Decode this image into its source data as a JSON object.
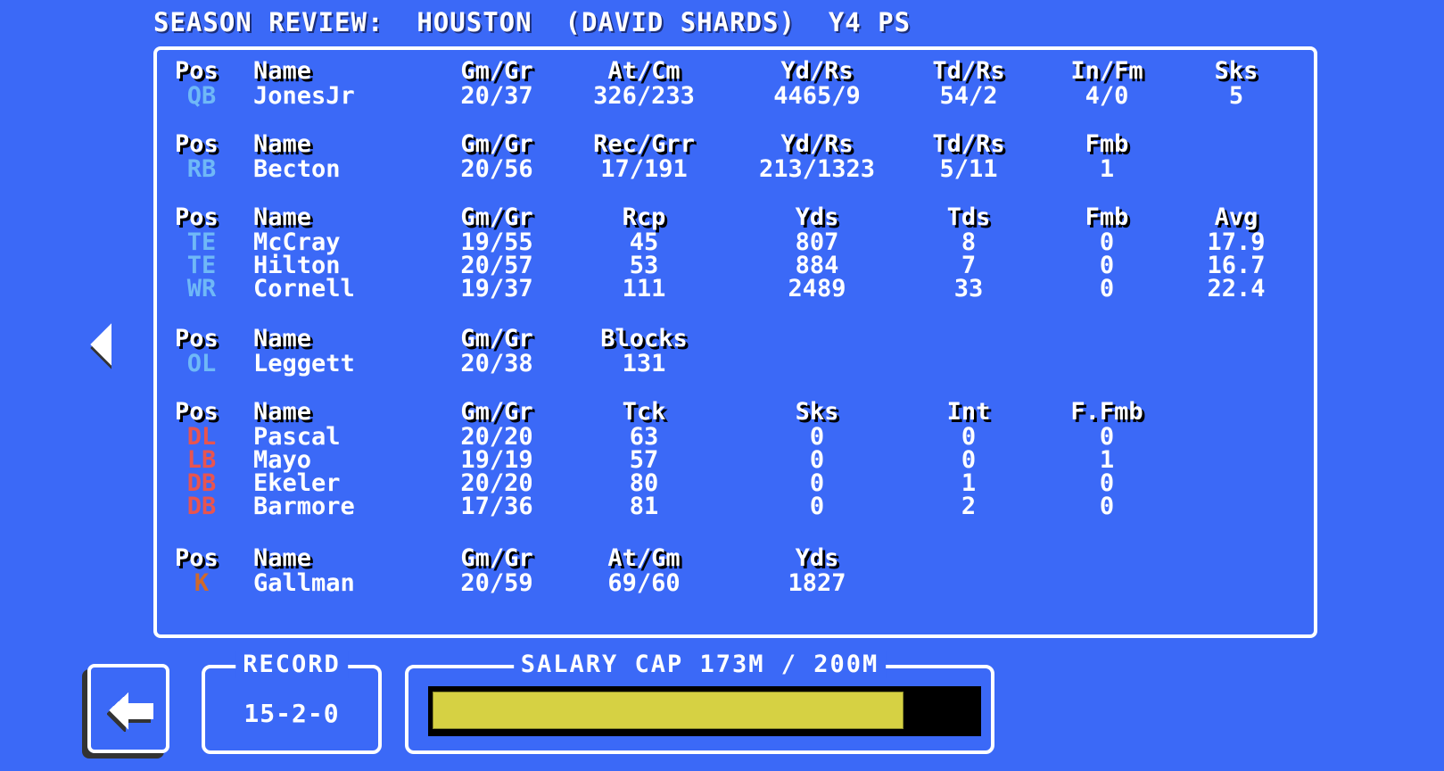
{
  "title": "SEASON REVIEW:  HOUSTON  (DAVID SHARDS)  Y4 PS",
  "colors": {
    "background": "#3b69f7",
    "offense_pos": "#6fb8f7",
    "defense_pos": "#e85450",
    "kicker_pos": "#d0692a",
    "cap_fill": "#d6d143",
    "cap_track": "#000000"
  },
  "sections": [
    {
      "id": "qb",
      "headers": [
        "Pos",
        "Name",
        "Gm/Gr",
        "At/Cm",
        "Yd/Rs",
        "Td/Rs",
        "In/Fm",
        "Sks"
      ],
      "rows": [
        {
          "pos": "QB",
          "group": "offense",
          "cells": [
            "JonesJr",
            "20/37",
            "326/233",
            "4465/9",
            "54/2",
            "4/0",
            "5"
          ]
        }
      ]
    },
    {
      "id": "rb",
      "headers": [
        "Pos",
        "Name",
        "Gm/Gr",
        "Rec/Grr",
        "Yd/Rs",
        "Td/Rs",
        "Fmb"
      ],
      "rows": [
        {
          "pos": "RB",
          "group": "offense",
          "cells": [
            "Becton",
            "20/56",
            "17/191",
            "213/1323",
            "5/11",
            "1"
          ]
        }
      ]
    },
    {
      "id": "receivers",
      "headers": [
        "Pos",
        "Name",
        "Gm/Gr",
        "Rcp",
        "Yds",
        "Tds",
        "Fmb",
        "Avg"
      ],
      "rows": [
        {
          "pos": "TE",
          "group": "offense",
          "cells": [
            "McCray",
            "19/55",
            "45",
            "807",
            "8",
            "0",
            "17.9"
          ]
        },
        {
          "pos": "TE",
          "group": "offense",
          "cells": [
            "Hilton",
            "20/57",
            "53",
            "884",
            "7",
            "0",
            "16.7"
          ]
        },
        {
          "pos": "WR",
          "group": "offense",
          "cells": [
            "Cornell",
            "19/37",
            "111",
            "2489",
            "33",
            "0",
            "22.4"
          ]
        }
      ]
    },
    {
      "id": "ol",
      "headers": [
        "Pos",
        "Name",
        "Gm/Gr",
        "Blocks"
      ],
      "rows": [
        {
          "pos": "OL",
          "group": "offense",
          "cells": [
            "Leggett",
            "20/38",
            "131"
          ]
        }
      ]
    },
    {
      "id": "defense",
      "headers": [
        "Pos",
        "Name",
        "Gm/Gr",
        "Tck",
        "Sks",
        "Int",
        "F.Fmb"
      ],
      "rows": [
        {
          "pos": "DL",
          "group": "defense",
          "cells": [
            "Pascal",
            "20/20",
            "63",
            "0",
            "0",
            "0"
          ]
        },
        {
          "pos": "LB",
          "group": "defense",
          "cells": [
            "Mayo",
            "19/19",
            "57",
            "0",
            "0",
            "1"
          ]
        },
        {
          "pos": "DB",
          "group": "defense",
          "cells": [
            "Ekeler",
            "20/20",
            "80",
            "0",
            "1",
            "0"
          ]
        },
        {
          "pos": "DB",
          "group": "defense",
          "cells": [
            "Barmore",
            "17/36",
            "81",
            "0",
            "2",
            "0"
          ]
        }
      ]
    },
    {
      "id": "kicker",
      "headers": [
        "Pos",
        "Name",
        "Gm/Gr",
        "At/Gm",
        "Yds"
      ],
      "rows": [
        {
          "pos": "K",
          "group": "kicker",
          "cells": [
            "Gallman",
            "20/59",
            "69/60",
            "1827"
          ]
        }
      ]
    }
  ],
  "record": {
    "label": "RECORD",
    "value": "15-2-0"
  },
  "salary_cap": {
    "label": "SALARY CAP 173M / 200M",
    "used_millions": 173,
    "cap_millions": 200,
    "fraction": 0.865
  },
  "icons": {
    "prev": "triangle-left-icon",
    "back": "arrow-left-icon"
  }
}
